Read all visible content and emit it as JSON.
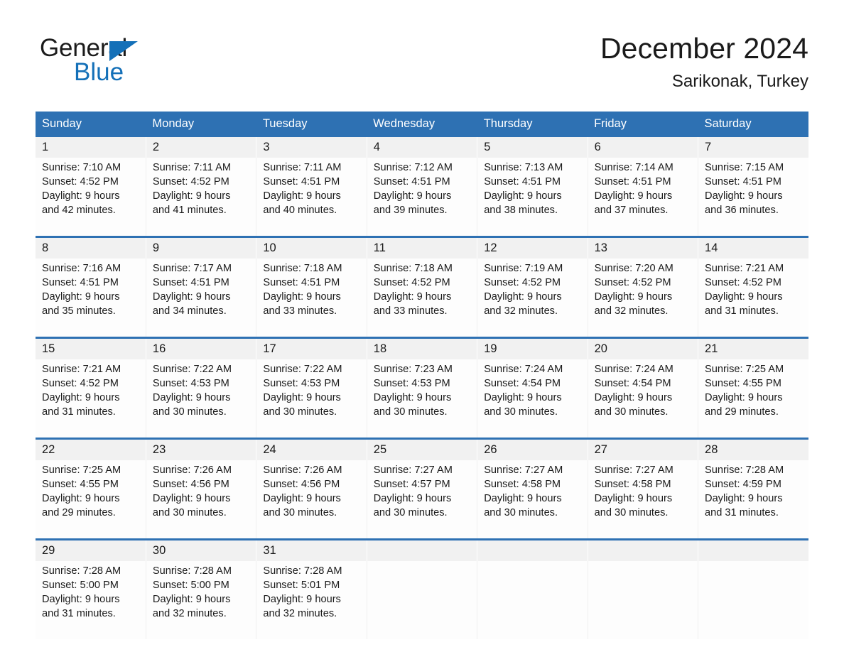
{
  "brand": {
    "name_part1": "General",
    "name_part2": "Blue",
    "accent_color": "#1470b8"
  },
  "header": {
    "title": "December 2024",
    "subtitle": "Sarikonak, Turkey"
  },
  "theme": {
    "header_blue": "#2e71b3",
    "date_row_gray": "#f1f1f1",
    "cell_background": "#fdfdfd"
  },
  "weekdays": [
    "Sunday",
    "Monday",
    "Tuesday",
    "Wednesday",
    "Thursday",
    "Friday",
    "Saturday"
  ],
  "weeks": [
    {
      "days": [
        {
          "date": "1",
          "sunrise": "Sunrise: 7:10 AM",
          "sunset": "Sunset: 4:52 PM",
          "daylight_line1": "Daylight: 9 hours",
          "daylight_line2": "and 42 minutes."
        },
        {
          "date": "2",
          "sunrise": "Sunrise: 7:11 AM",
          "sunset": "Sunset: 4:52 PM",
          "daylight_line1": "Daylight: 9 hours",
          "daylight_line2": "and 41 minutes."
        },
        {
          "date": "3",
          "sunrise": "Sunrise: 7:11 AM",
          "sunset": "Sunset: 4:51 PM",
          "daylight_line1": "Daylight: 9 hours",
          "daylight_line2": "and 40 minutes."
        },
        {
          "date": "4",
          "sunrise": "Sunrise: 7:12 AM",
          "sunset": "Sunset: 4:51 PM",
          "daylight_line1": "Daylight: 9 hours",
          "daylight_line2": "and 39 minutes."
        },
        {
          "date": "5",
          "sunrise": "Sunrise: 7:13 AM",
          "sunset": "Sunset: 4:51 PM",
          "daylight_line1": "Daylight: 9 hours",
          "daylight_line2": "and 38 minutes."
        },
        {
          "date": "6",
          "sunrise": "Sunrise: 7:14 AM",
          "sunset": "Sunset: 4:51 PM",
          "daylight_line1": "Daylight: 9 hours",
          "daylight_line2": "and 37 minutes."
        },
        {
          "date": "7",
          "sunrise": "Sunrise: 7:15 AM",
          "sunset": "Sunset: 4:51 PM",
          "daylight_line1": "Daylight: 9 hours",
          "daylight_line2": "and 36 minutes."
        }
      ]
    },
    {
      "days": [
        {
          "date": "8",
          "sunrise": "Sunrise: 7:16 AM",
          "sunset": "Sunset: 4:51 PM",
          "daylight_line1": "Daylight: 9 hours",
          "daylight_line2": "and 35 minutes."
        },
        {
          "date": "9",
          "sunrise": "Sunrise: 7:17 AM",
          "sunset": "Sunset: 4:51 PM",
          "daylight_line1": "Daylight: 9 hours",
          "daylight_line2": "and 34 minutes."
        },
        {
          "date": "10",
          "sunrise": "Sunrise: 7:18 AM",
          "sunset": "Sunset: 4:51 PM",
          "daylight_line1": "Daylight: 9 hours",
          "daylight_line2": "and 33 minutes."
        },
        {
          "date": "11",
          "sunrise": "Sunrise: 7:18 AM",
          "sunset": "Sunset: 4:52 PM",
          "daylight_line1": "Daylight: 9 hours",
          "daylight_line2": "and 33 minutes."
        },
        {
          "date": "12",
          "sunrise": "Sunrise: 7:19 AM",
          "sunset": "Sunset: 4:52 PM",
          "daylight_line1": "Daylight: 9 hours",
          "daylight_line2": "and 32 minutes."
        },
        {
          "date": "13",
          "sunrise": "Sunrise: 7:20 AM",
          "sunset": "Sunset: 4:52 PM",
          "daylight_line1": "Daylight: 9 hours",
          "daylight_line2": "and 32 minutes."
        },
        {
          "date": "14",
          "sunrise": "Sunrise: 7:21 AM",
          "sunset": "Sunset: 4:52 PM",
          "daylight_line1": "Daylight: 9 hours",
          "daylight_line2": "and 31 minutes."
        }
      ]
    },
    {
      "days": [
        {
          "date": "15",
          "sunrise": "Sunrise: 7:21 AM",
          "sunset": "Sunset: 4:52 PM",
          "daylight_line1": "Daylight: 9 hours",
          "daylight_line2": "and 31 minutes."
        },
        {
          "date": "16",
          "sunrise": "Sunrise: 7:22 AM",
          "sunset": "Sunset: 4:53 PM",
          "daylight_line1": "Daylight: 9 hours",
          "daylight_line2": "and 30 minutes."
        },
        {
          "date": "17",
          "sunrise": "Sunrise: 7:22 AM",
          "sunset": "Sunset: 4:53 PM",
          "daylight_line1": "Daylight: 9 hours",
          "daylight_line2": "and 30 minutes."
        },
        {
          "date": "18",
          "sunrise": "Sunrise: 7:23 AM",
          "sunset": "Sunset: 4:53 PM",
          "daylight_line1": "Daylight: 9 hours",
          "daylight_line2": "and 30 minutes."
        },
        {
          "date": "19",
          "sunrise": "Sunrise: 7:24 AM",
          "sunset": "Sunset: 4:54 PM",
          "daylight_line1": "Daylight: 9 hours",
          "daylight_line2": "and 30 minutes."
        },
        {
          "date": "20",
          "sunrise": "Sunrise: 7:24 AM",
          "sunset": "Sunset: 4:54 PM",
          "daylight_line1": "Daylight: 9 hours",
          "daylight_line2": "and 30 minutes."
        },
        {
          "date": "21",
          "sunrise": "Sunrise: 7:25 AM",
          "sunset": "Sunset: 4:55 PM",
          "daylight_line1": "Daylight: 9 hours",
          "daylight_line2": "and 29 minutes."
        }
      ]
    },
    {
      "days": [
        {
          "date": "22",
          "sunrise": "Sunrise: 7:25 AM",
          "sunset": "Sunset: 4:55 PM",
          "daylight_line1": "Daylight: 9 hours",
          "daylight_line2": "and 29 minutes."
        },
        {
          "date": "23",
          "sunrise": "Sunrise: 7:26 AM",
          "sunset": "Sunset: 4:56 PM",
          "daylight_line1": "Daylight: 9 hours",
          "daylight_line2": "and 30 minutes."
        },
        {
          "date": "24",
          "sunrise": "Sunrise: 7:26 AM",
          "sunset": "Sunset: 4:56 PM",
          "daylight_line1": "Daylight: 9 hours",
          "daylight_line2": "and 30 minutes."
        },
        {
          "date": "25",
          "sunrise": "Sunrise: 7:27 AM",
          "sunset": "Sunset: 4:57 PM",
          "daylight_line1": "Daylight: 9 hours",
          "daylight_line2": "and 30 minutes."
        },
        {
          "date": "26",
          "sunrise": "Sunrise: 7:27 AM",
          "sunset": "Sunset: 4:58 PM",
          "daylight_line1": "Daylight: 9 hours",
          "daylight_line2": "and 30 minutes."
        },
        {
          "date": "27",
          "sunrise": "Sunrise: 7:27 AM",
          "sunset": "Sunset: 4:58 PM",
          "daylight_line1": "Daylight: 9 hours",
          "daylight_line2": "and 30 minutes."
        },
        {
          "date": "28",
          "sunrise": "Sunrise: 7:28 AM",
          "sunset": "Sunset: 4:59 PM",
          "daylight_line1": "Daylight: 9 hours",
          "daylight_line2": "and 31 minutes."
        }
      ]
    },
    {
      "days": [
        {
          "date": "29",
          "sunrise": "Sunrise: 7:28 AM",
          "sunset": "Sunset: 5:00 PM",
          "daylight_line1": "Daylight: 9 hours",
          "daylight_line2": "and 31 minutes."
        },
        {
          "date": "30",
          "sunrise": "Sunrise: 7:28 AM",
          "sunset": "Sunset: 5:00 PM",
          "daylight_line1": "Daylight: 9 hours",
          "daylight_line2": "and 32 minutes."
        },
        {
          "date": "31",
          "sunrise": "Sunrise: 7:28 AM",
          "sunset": "Sunset: 5:01 PM",
          "daylight_line1": "Daylight: 9 hours",
          "daylight_line2": "and 32 minutes."
        },
        {
          "date": "",
          "sunrise": "",
          "sunset": "",
          "daylight_line1": "",
          "daylight_line2": ""
        },
        {
          "date": "",
          "sunrise": "",
          "sunset": "",
          "daylight_line1": "",
          "daylight_line2": ""
        },
        {
          "date": "",
          "sunrise": "",
          "sunset": "",
          "daylight_line1": "",
          "daylight_line2": ""
        },
        {
          "date": "",
          "sunrise": "",
          "sunset": "",
          "daylight_line1": "",
          "daylight_line2": ""
        }
      ]
    }
  ]
}
